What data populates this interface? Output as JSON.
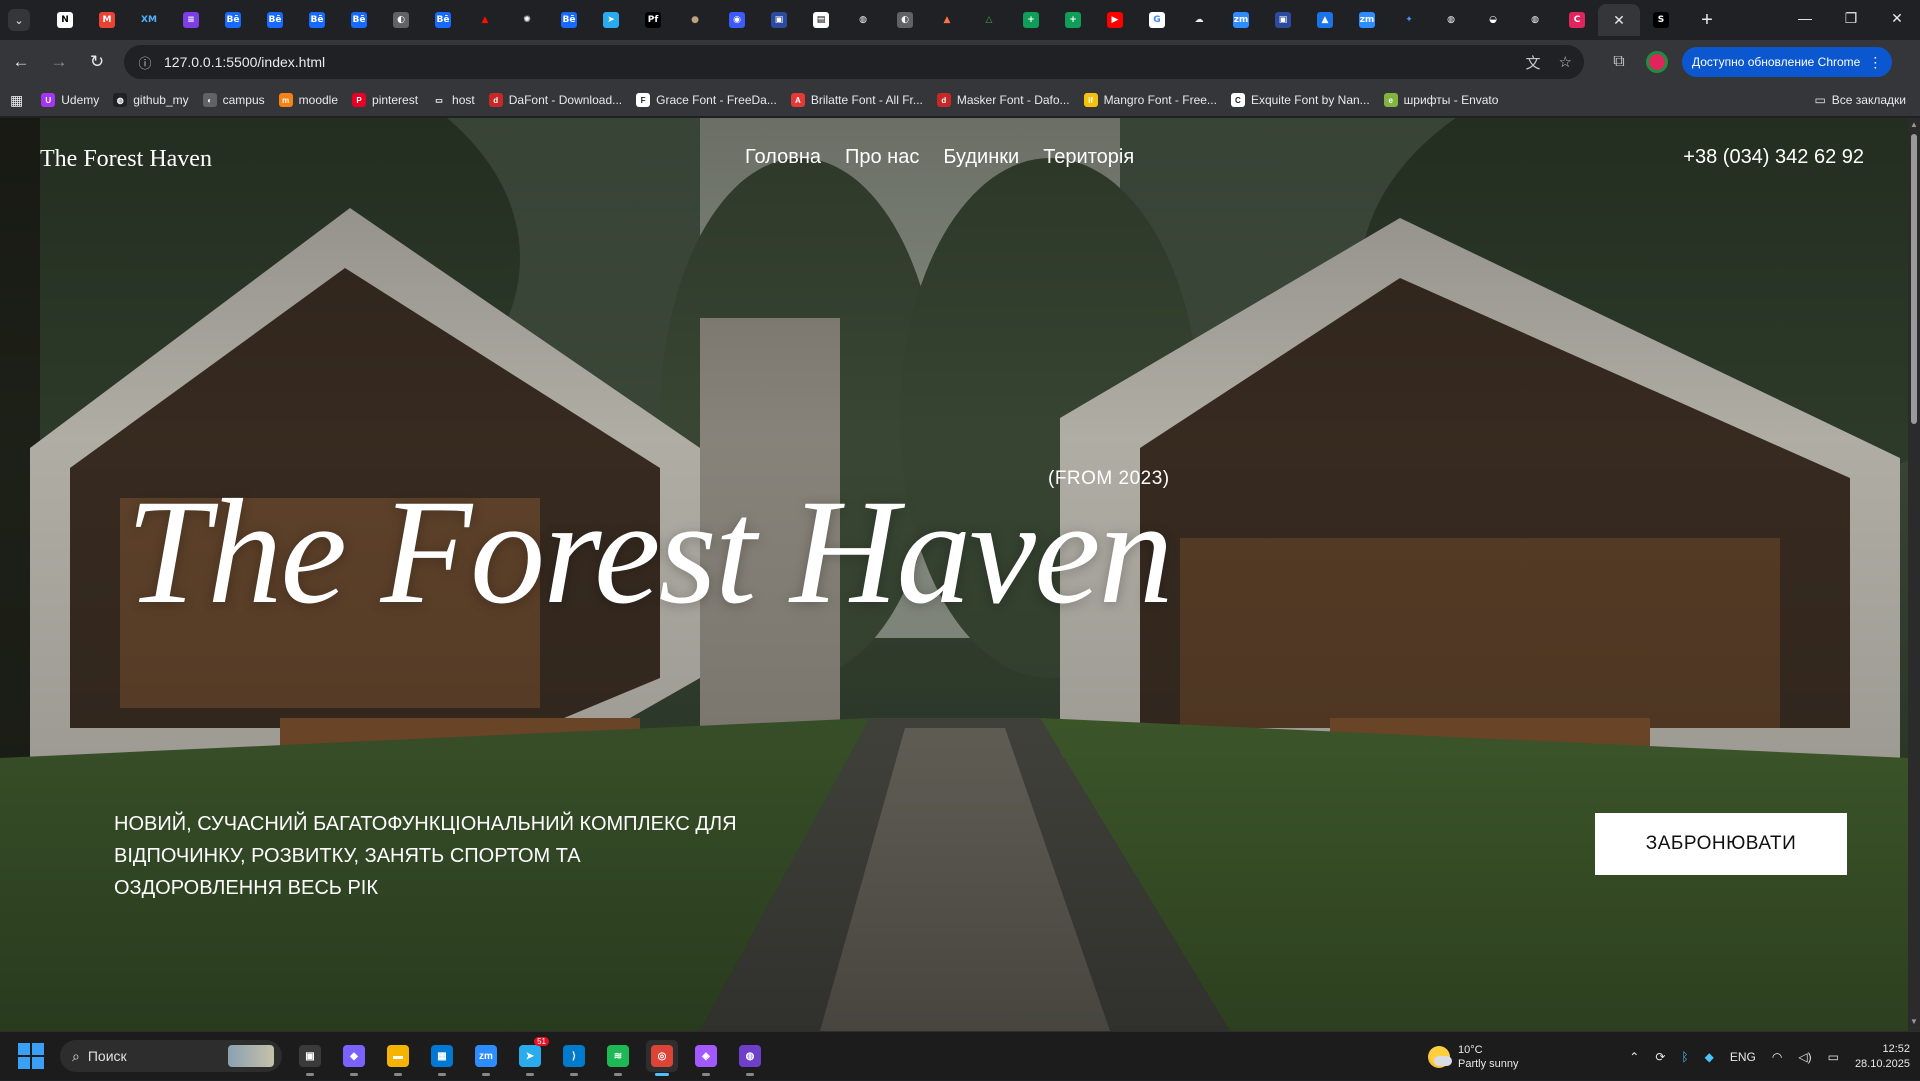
{
  "browser": {
    "tabs": [
      {
        "icon": "notion-icon",
        "glyph": "N",
        "color": "#ffffff",
        "fg": "#000000"
      },
      {
        "icon": "gmail-icon",
        "glyph": "M",
        "color": "#ea4335",
        "fg": "#ffffff"
      },
      {
        "icon": "xm-icon",
        "glyph": "XM",
        "color": "#202124",
        "fg": "#4fb3ff"
      },
      {
        "icon": "list-app-icon",
        "glyph": "≡",
        "color": "#7b3fe4",
        "fg": "#ffffff"
      },
      {
        "icon": "behance-icon",
        "glyph": "Bē",
        "color": "#1769ff",
        "fg": "#ffffff"
      },
      {
        "icon": "behance-icon",
        "glyph": "Bē",
        "color": "#1769ff",
        "fg": "#ffffff"
      },
      {
        "icon": "behance-icon",
        "glyph": "Bē",
        "color": "#1769ff",
        "fg": "#ffffff"
      },
      {
        "icon": "behance-icon",
        "glyph": "Bē",
        "color": "#1769ff",
        "fg": "#ffffff"
      },
      {
        "icon": "globe-icon",
        "glyph": "◐",
        "color": "#5f6368",
        "fg": "#ffffff"
      },
      {
        "icon": "behance-icon",
        "glyph": "Bē",
        "color": "#1769ff",
        "fg": "#ffffff"
      },
      {
        "icon": "adobe-icon",
        "glyph": "▲",
        "color": "#202124",
        "fg": "#fa0f00"
      },
      {
        "icon": "chatgpt-icon",
        "glyph": "✺",
        "color": "#202124",
        "fg": "#ffffff"
      },
      {
        "icon": "behance-icon",
        "glyph": "Bē",
        "color": "#1769ff",
        "fg": "#ffffff"
      },
      {
        "icon": "telegram-icon",
        "glyph": "➤",
        "color": "#2aabee",
        "fg": "#ffffff"
      },
      {
        "icon": "pf-icon",
        "glyph": "Pf",
        "color": "#000000",
        "fg": "#ffffff"
      },
      {
        "icon": "avatar-icon",
        "glyph": "●",
        "color": "#202124",
        "fg": "#c0a080"
      },
      {
        "icon": "app-icon",
        "glyph": "◉",
        "color": "#3d5afe",
        "fg": "#ffffff"
      },
      {
        "icon": "app-icon",
        "glyph": "▣",
        "color": "#2c4a9e",
        "fg": "#ffffff"
      },
      {
        "icon": "doc-icon",
        "glyph": "▤",
        "color": "#ffffff",
        "fg": "#000000"
      },
      {
        "icon": "github-icon",
        "glyph": "◍",
        "color": "#202124",
        "fg": "#ffffff"
      },
      {
        "icon": "globe-icon",
        "glyph": "◐",
        "color": "#5f6368",
        "fg": "#ffffff"
      },
      {
        "icon": "flame-icon",
        "glyph": "▲",
        "color": "#202124",
        "fg": "#ff7043"
      },
      {
        "icon": "drive-icon",
        "glyph": "△",
        "color": "#202124",
        "fg": "#34a853"
      },
      {
        "icon": "sheets-icon",
        "glyph": "+",
        "color": "#0f9d58",
        "fg": "#ffffff"
      },
      {
        "icon": "sheets-icon",
        "glyph": "+",
        "color": "#0f9d58",
        "fg": "#ffffff"
      },
      {
        "icon": "youtube-icon",
        "glyph": "▶",
        "color": "#ff0000",
        "fg": "#ffffff"
      },
      {
        "icon": "google-icon",
        "glyph": "G",
        "color": "#ffffff",
        "fg": "#4285f4"
      },
      {
        "icon": "cloud-icon",
        "glyph": "☁",
        "color": "#202124",
        "fg": "#e8eaed"
      },
      {
        "icon": "zoom-icon",
        "glyph": "zm",
        "color": "#2d8cff",
        "fg": "#ffffff"
      },
      {
        "icon": "app-icon",
        "glyph": "▣",
        "color": "#2c4a9e",
        "fg": "#ffffff"
      },
      {
        "icon": "image-icon",
        "glyph": "▲",
        "color": "#1a73e8",
        "fg": "#ffffff"
      },
      {
        "icon": "zoom-icon",
        "glyph": "zm",
        "color": "#2d8cff",
        "fg": "#ffffff"
      },
      {
        "icon": "gemini-icon",
        "glyph": "✦",
        "color": "#202124",
        "fg": "#4c8df6"
      },
      {
        "icon": "github-icon",
        "glyph": "◍",
        "color": "#202124",
        "fg": "#ffffff"
      },
      {
        "icon": "team-icon",
        "glyph": "◒",
        "color": "#202124",
        "fg": "#ffffff"
      },
      {
        "icon": "github-icon",
        "glyph": "◍",
        "color": "#202124",
        "fg": "#ffffff"
      },
      {
        "icon": "c-app-icon",
        "glyph": "C",
        "color": "#e0245e",
        "fg": "#ffffff"
      },
      {
        "icon": "close-icon",
        "glyph": "✕",
        "color": "transparent",
        "fg": "#e8eaed",
        "active": true
      },
      {
        "icon": "s-app-icon",
        "glyph": "S",
        "color": "#000000",
        "fg": "#ffffff"
      }
    ],
    "url": "127.0.0.1:5500/index.html",
    "update_label": "Доступно обновление Chrome",
    "bookmarks": [
      {
        "label": "Udemy",
        "icon": "udemy-icon",
        "color": "#a435f0",
        "glyph": "U"
      },
      {
        "label": "github_my",
        "icon": "github-icon",
        "color": "#202124",
        "glyph": "◍"
      },
      {
        "label": "campus",
        "icon": "globe-icon",
        "color": "#5f6368",
        "glyph": "◐"
      },
      {
        "label": "moodle",
        "icon": "moodle-icon",
        "color": "#f98012",
        "glyph": "m"
      },
      {
        "label": "pinterest",
        "icon": "pinterest-icon",
        "color": "#e60023",
        "glyph": "P"
      },
      {
        "label": "host",
        "icon": "folder-icon",
        "color": "#35363a",
        "glyph": "▭"
      },
      {
        "label": "DaFont - Download...",
        "icon": "dafont-icon",
        "color": "#c62828",
        "glyph": "d"
      },
      {
        "label": "Grace Font - FreeDa...",
        "icon": "freeda-icon",
        "color": "#ffffff",
        "glyph": "F"
      },
      {
        "label": "Brilatte Font - All Fr...",
        "icon": "allfree-icon",
        "color": "#e53935",
        "glyph": "A"
      },
      {
        "label": "Masker Font - Dafo...",
        "icon": "dafont-icon",
        "color": "#c62828",
        "glyph": "d"
      },
      {
        "label": "Mangro Font - Free...",
        "icon": "if-icon",
        "color": "#f4c20d",
        "glyph": "if"
      },
      {
        "label": "Exquite Font by Nan...",
        "icon": "creative-icon",
        "color": "#ffffff",
        "glyph": "C"
      },
      {
        "label": "шрифты - Envato",
        "icon": "envato-icon",
        "color": "#81b441",
        "glyph": "e"
      }
    ],
    "all_bookmarks": "Все закладки"
  },
  "site": {
    "logo": "The Forest Haven",
    "nav": [
      "Головна",
      "Про нас",
      "Будинки",
      "Територія"
    ],
    "phone": "+38 (034) 342 62 92",
    "from_label": "(FROM 2023)",
    "hero_title": "The Forest Haven",
    "hero_subtitle": "Новий, сучасний багатофункціональний комплекс для відпочинку, розвитку, занять спортом та оздоровлення весь рік",
    "cta": "ЗАБРОНЮВАТИ"
  },
  "taskbar": {
    "search_placeholder": "Поиск",
    "apps": [
      {
        "icon": "task-view-icon",
        "glyph": "▣",
        "color": "#3a3a3a"
      },
      {
        "icon": "copilot-icon",
        "glyph": "◆",
        "color": "#7b61ff"
      },
      {
        "icon": "file-explorer-icon",
        "glyph": "▬",
        "color": "#f4b400"
      },
      {
        "icon": "store-icon",
        "glyph": "▦",
        "color": "#0078d4"
      },
      {
        "icon": "zoom-icon",
        "glyph": "zm",
        "color": "#2d8cff"
      },
      {
        "icon": "telegram-icon",
        "glyph": "➤",
        "color": "#2aabee",
        "badge": "51"
      },
      {
        "icon": "vscode-icon",
        "glyph": "⟩",
        "color": "#007acc"
      },
      {
        "icon": "spotify-icon",
        "glyph": "≋",
        "color": "#1db954"
      },
      {
        "icon": "chrome-icon",
        "glyph": "◎",
        "color": "#db4437",
        "active": true
      },
      {
        "icon": "figma-icon",
        "glyph": "◈",
        "color": "#a259ff"
      },
      {
        "icon": "github-desktop-icon",
        "glyph": "◍",
        "color": "#6e40c9"
      }
    ],
    "weather_temp": "10°C",
    "weather_desc": "Partly sunny",
    "lang": "ENG",
    "time": "12:52",
    "date": "28.10.2025"
  }
}
